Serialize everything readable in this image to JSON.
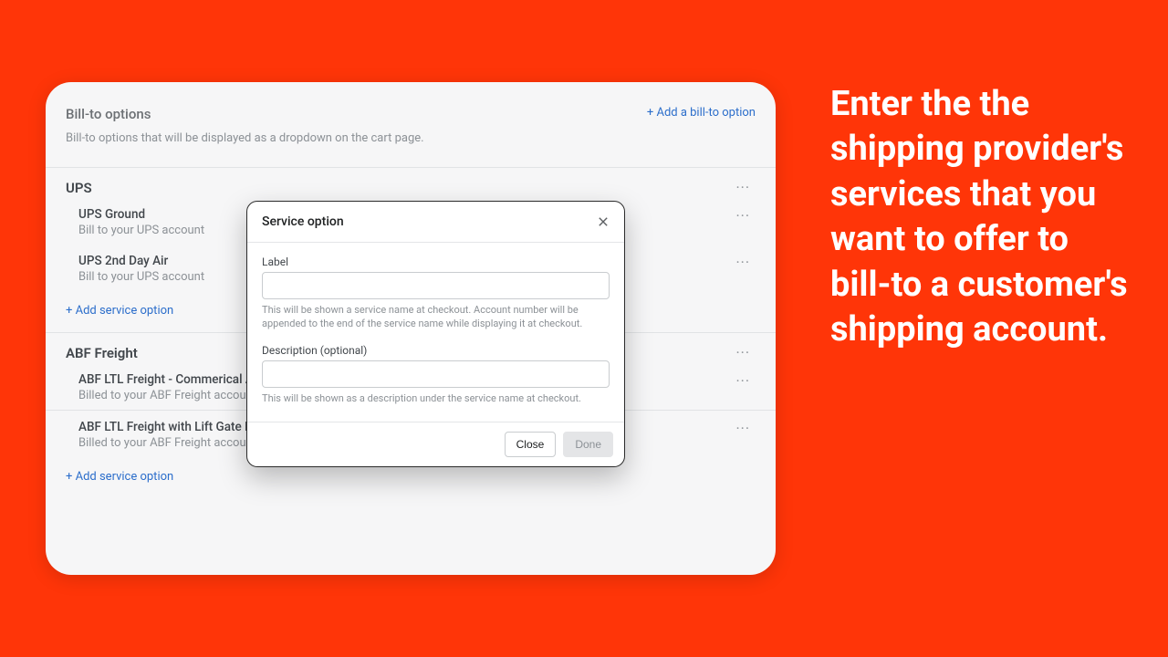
{
  "hero_text": "Enter the the shipping provider's services that you want to offer to bill-to a customer's shipping account.",
  "card": {
    "title": "Bill-to options",
    "add_link": "+ Add a bill-to option",
    "subtitle": "Bill-to options that will be displayed as a dropdown on the cart page."
  },
  "providers": {
    "0": {
      "name": "UPS",
      "add_label": "+ Add service option",
      "services": {
        "0": {
          "label": "UPS Ground",
          "desc": "Bill to your UPS account"
        },
        "1": {
          "label": "UPS 2nd Day Air",
          "desc": "Bill to your UPS account"
        }
      }
    },
    "1": {
      "name": "ABF Freight",
      "add_label": "+ Add service option",
      "services": {
        "0": {
          "label": "ABF LTL Freight - Commerical Address",
          "desc": "Billed to your ABF Freight account."
        },
        "1": {
          "label": "ABF LTL Freight with Lift Gate Delivery - Commercial Address",
          "desc": "Billed to your ABF Freight account."
        }
      }
    }
  },
  "modal": {
    "title": "Service option",
    "label_field": "Label",
    "label_help": "This will be shown a service name at checkout. Account number will be appended to the end of the service name while displaying it at checkout.",
    "desc_field": "Description (optional)",
    "desc_help": "This will be shown as a description under the service name at checkout.",
    "close": "Close",
    "done": "Done"
  }
}
